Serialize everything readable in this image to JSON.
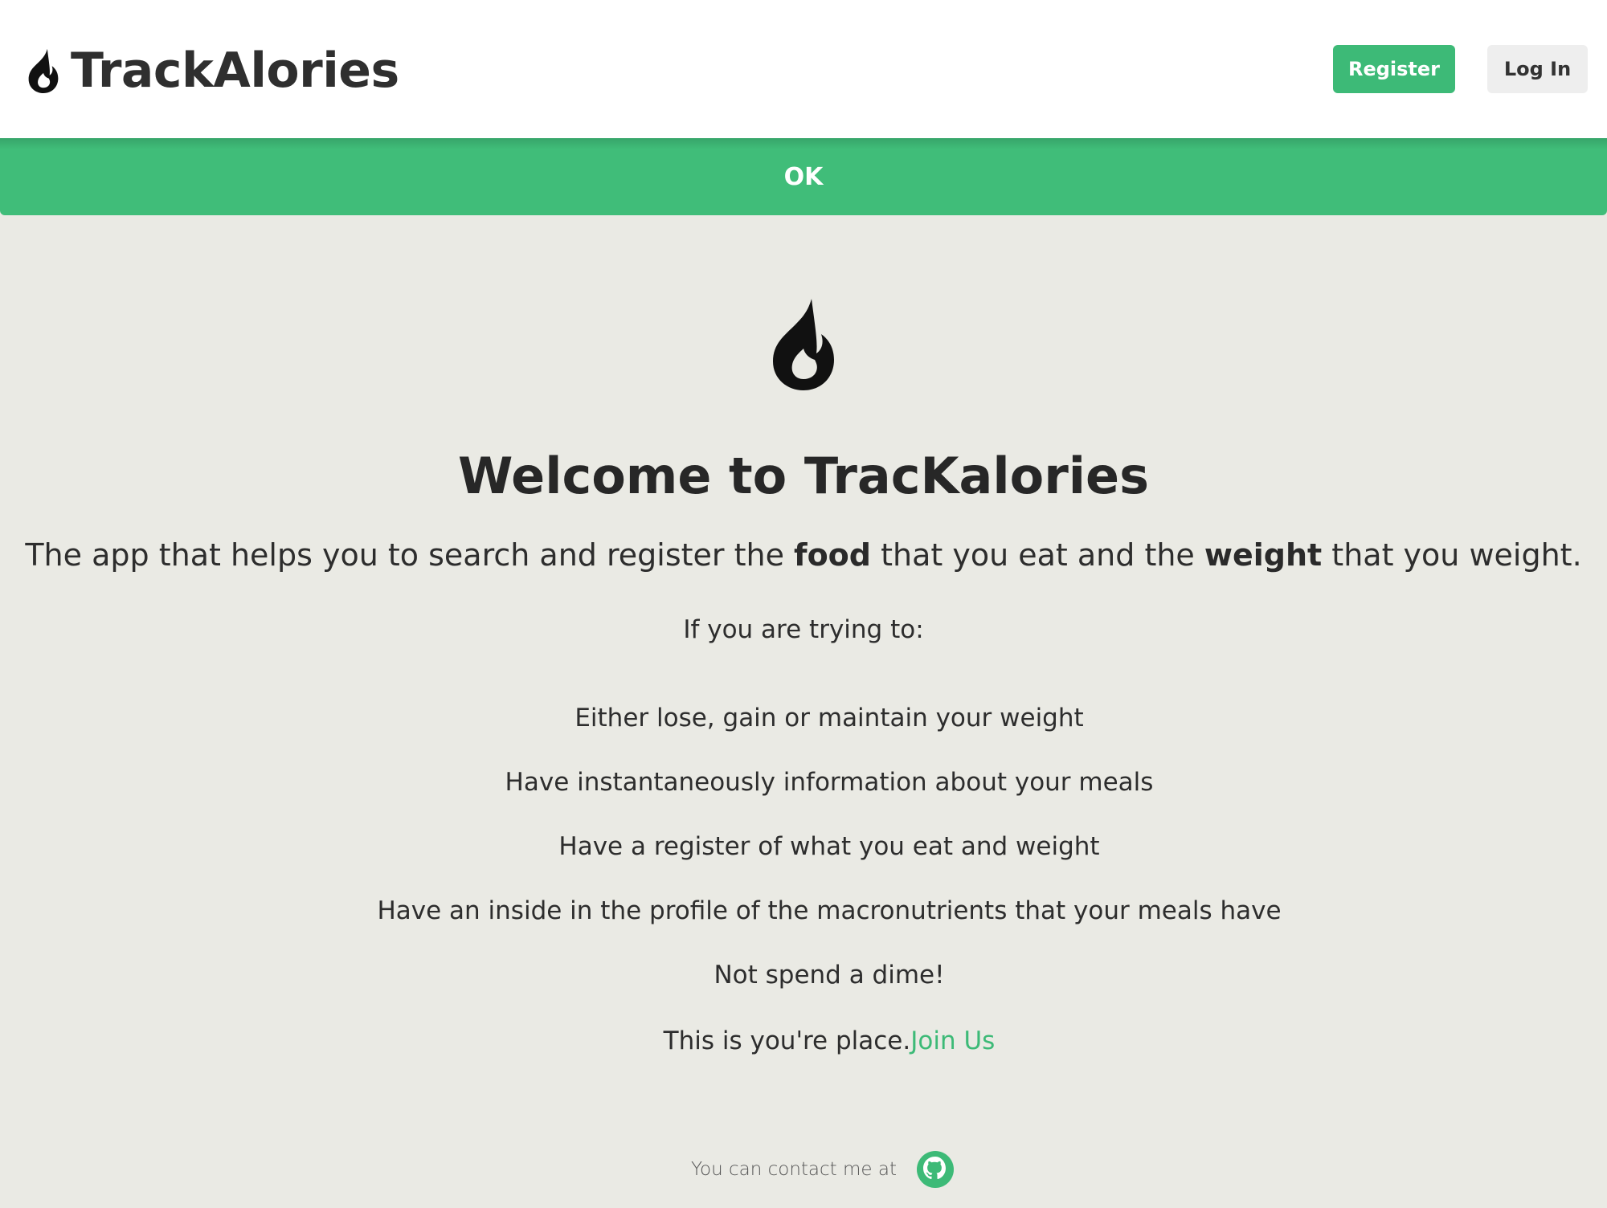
{
  "header": {
    "brand_title": "TrackAlories",
    "brand_icon": "fire-icon",
    "register_label": "Register",
    "login_label": "Log In"
  },
  "alert": {
    "label": "OK"
  },
  "main": {
    "hero_icon": "fire-icon",
    "welcome_title": "Welcome to TracKalories",
    "tagline": {
      "part1": "The app that helps you to search and register the ",
      "bold1": "food",
      "part2": " that you eat and the ",
      "bold2": "weight",
      "part3": " that you weight."
    },
    "intro": "If you are trying to:",
    "goals": [
      "Either lose, gain or maintain your weight",
      "Have instantaneously information about your meals",
      "Have a register of what you eat and weight",
      "Have an inside in the profile of the macronutrients that your meals have",
      "Not spend a dime!"
    ],
    "join_text": "This is you're place.",
    "join_link": "Join Us"
  },
  "footer": {
    "contact_text": "You can contact me at",
    "contact_icon": "github-icon"
  },
  "colors": {
    "accent": "#3dba77",
    "background": "#eaeae4",
    "header_bg": "#ffffff"
  }
}
